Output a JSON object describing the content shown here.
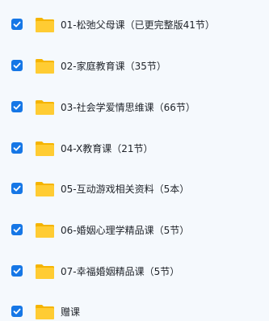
{
  "colors": {
    "checkbox": "#1677e6",
    "folder_back": "#f5b400",
    "folder_front": "#ffcc33",
    "text": "#1f2329",
    "background": "#f5f9fd"
  },
  "items": [
    {
      "label": "01-松弛父母课（已更完整版41节）",
      "checked": true,
      "icon": "folder-icon"
    },
    {
      "label": "02-家庭教育课（35节）",
      "checked": true,
      "icon": "folder-icon"
    },
    {
      "label": "03-社会学爱情思维课（66节）",
      "checked": true,
      "icon": "folder-icon"
    },
    {
      "label": "04-X教育课（21节）",
      "checked": true,
      "icon": "folder-icon"
    },
    {
      "label": "05-互动游戏相关资料（5本）",
      "checked": true,
      "icon": "folder-icon"
    },
    {
      "label": "06-婚姻心理学精品课（5节）",
      "checked": true,
      "icon": "folder-icon"
    },
    {
      "label": "07-幸福婚姻精品课（5节）",
      "checked": true,
      "icon": "folder-icon"
    },
    {
      "label": "赠课",
      "checked": true,
      "icon": "folder-icon"
    }
  ]
}
